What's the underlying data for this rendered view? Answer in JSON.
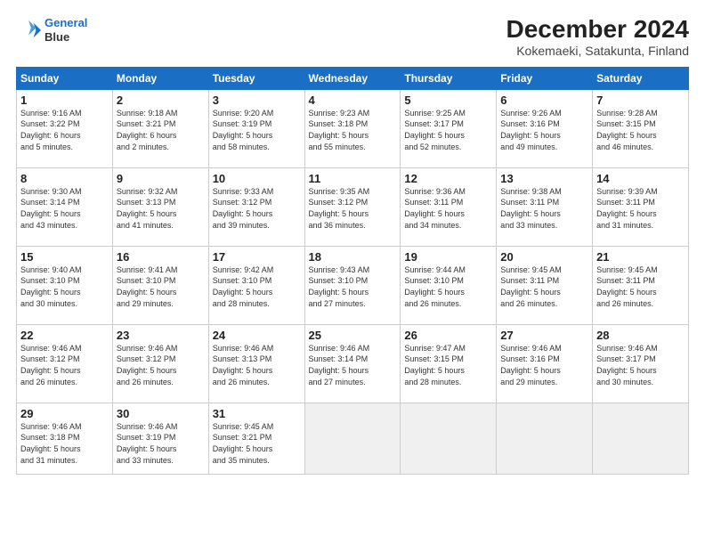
{
  "header": {
    "logo_line1": "General",
    "logo_line2": "Blue",
    "main_title": "December 2024",
    "subtitle": "Kokemaeki, Satakunta, Finland"
  },
  "days_of_week": [
    "Sunday",
    "Monday",
    "Tuesday",
    "Wednesday",
    "Thursday",
    "Friday",
    "Saturday"
  ],
  "weeks": [
    [
      {
        "day": "1",
        "info": "Sunrise: 9:16 AM\nSunset: 3:22 PM\nDaylight: 6 hours\nand 5 minutes."
      },
      {
        "day": "2",
        "info": "Sunrise: 9:18 AM\nSunset: 3:21 PM\nDaylight: 6 hours\nand 2 minutes."
      },
      {
        "day": "3",
        "info": "Sunrise: 9:20 AM\nSunset: 3:19 PM\nDaylight: 5 hours\nand 58 minutes."
      },
      {
        "day": "4",
        "info": "Sunrise: 9:23 AM\nSunset: 3:18 PM\nDaylight: 5 hours\nand 55 minutes."
      },
      {
        "day": "5",
        "info": "Sunrise: 9:25 AM\nSunset: 3:17 PM\nDaylight: 5 hours\nand 52 minutes."
      },
      {
        "day": "6",
        "info": "Sunrise: 9:26 AM\nSunset: 3:16 PM\nDaylight: 5 hours\nand 49 minutes."
      },
      {
        "day": "7",
        "info": "Sunrise: 9:28 AM\nSunset: 3:15 PM\nDaylight: 5 hours\nand 46 minutes."
      }
    ],
    [
      {
        "day": "8",
        "info": "Sunrise: 9:30 AM\nSunset: 3:14 PM\nDaylight: 5 hours\nand 43 minutes."
      },
      {
        "day": "9",
        "info": "Sunrise: 9:32 AM\nSunset: 3:13 PM\nDaylight: 5 hours\nand 41 minutes."
      },
      {
        "day": "10",
        "info": "Sunrise: 9:33 AM\nSunset: 3:12 PM\nDaylight: 5 hours\nand 39 minutes."
      },
      {
        "day": "11",
        "info": "Sunrise: 9:35 AM\nSunset: 3:12 PM\nDaylight: 5 hours\nand 36 minutes."
      },
      {
        "day": "12",
        "info": "Sunrise: 9:36 AM\nSunset: 3:11 PM\nDaylight: 5 hours\nand 34 minutes."
      },
      {
        "day": "13",
        "info": "Sunrise: 9:38 AM\nSunset: 3:11 PM\nDaylight: 5 hours\nand 33 minutes."
      },
      {
        "day": "14",
        "info": "Sunrise: 9:39 AM\nSunset: 3:11 PM\nDaylight: 5 hours\nand 31 minutes."
      }
    ],
    [
      {
        "day": "15",
        "info": "Sunrise: 9:40 AM\nSunset: 3:10 PM\nDaylight: 5 hours\nand 30 minutes."
      },
      {
        "day": "16",
        "info": "Sunrise: 9:41 AM\nSunset: 3:10 PM\nDaylight: 5 hours\nand 29 minutes."
      },
      {
        "day": "17",
        "info": "Sunrise: 9:42 AM\nSunset: 3:10 PM\nDaylight: 5 hours\nand 28 minutes."
      },
      {
        "day": "18",
        "info": "Sunrise: 9:43 AM\nSunset: 3:10 PM\nDaylight: 5 hours\nand 27 minutes."
      },
      {
        "day": "19",
        "info": "Sunrise: 9:44 AM\nSunset: 3:10 PM\nDaylight: 5 hours\nand 26 minutes."
      },
      {
        "day": "20",
        "info": "Sunrise: 9:45 AM\nSunset: 3:11 PM\nDaylight: 5 hours\nand 26 minutes."
      },
      {
        "day": "21",
        "info": "Sunrise: 9:45 AM\nSunset: 3:11 PM\nDaylight: 5 hours\nand 26 minutes."
      }
    ],
    [
      {
        "day": "22",
        "info": "Sunrise: 9:46 AM\nSunset: 3:12 PM\nDaylight: 5 hours\nand 26 minutes."
      },
      {
        "day": "23",
        "info": "Sunrise: 9:46 AM\nSunset: 3:12 PM\nDaylight: 5 hours\nand 26 minutes."
      },
      {
        "day": "24",
        "info": "Sunrise: 9:46 AM\nSunset: 3:13 PM\nDaylight: 5 hours\nand 26 minutes."
      },
      {
        "day": "25",
        "info": "Sunrise: 9:46 AM\nSunset: 3:14 PM\nDaylight: 5 hours\nand 27 minutes."
      },
      {
        "day": "26",
        "info": "Sunrise: 9:47 AM\nSunset: 3:15 PM\nDaylight: 5 hours\nand 28 minutes."
      },
      {
        "day": "27",
        "info": "Sunrise: 9:46 AM\nSunset: 3:16 PM\nDaylight: 5 hours\nand 29 minutes."
      },
      {
        "day": "28",
        "info": "Sunrise: 9:46 AM\nSunset: 3:17 PM\nDaylight: 5 hours\nand 30 minutes."
      }
    ],
    [
      {
        "day": "29",
        "info": "Sunrise: 9:46 AM\nSunset: 3:18 PM\nDaylight: 5 hours\nand 31 minutes."
      },
      {
        "day": "30",
        "info": "Sunrise: 9:46 AM\nSunset: 3:19 PM\nDaylight: 5 hours\nand 33 minutes."
      },
      {
        "day": "31",
        "info": "Sunrise: 9:45 AM\nSunset: 3:21 PM\nDaylight: 5 hours\nand 35 minutes."
      },
      null,
      null,
      null,
      null
    ]
  ]
}
